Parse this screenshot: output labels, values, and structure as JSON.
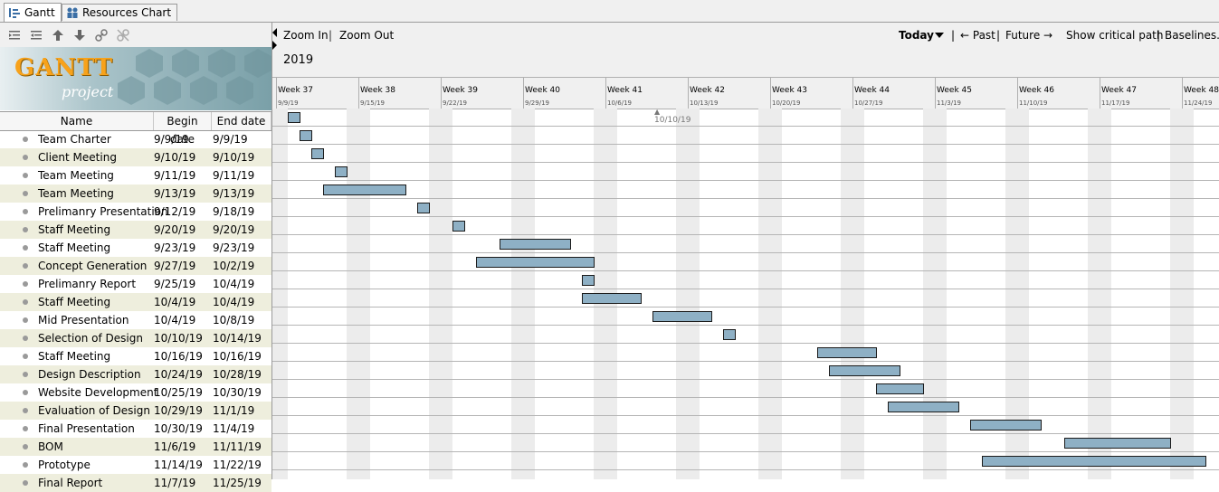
{
  "tabs": [
    {
      "label": "Gantt",
      "icon": "gantt-icon"
    },
    {
      "label": "Resources Chart",
      "icon": "resources-icon"
    }
  ],
  "toolbar_icons": [
    "indent-icon",
    "outdent-icon",
    "move-up-icon",
    "move-down-icon",
    "link-icon",
    "unlink-icon"
  ],
  "logo": {
    "word": "GANTT",
    "sub": "project"
  },
  "columns": {
    "name": "Name",
    "begin": "Begin date",
    "end": "End date"
  },
  "nav": {
    "zoom_in": "Zoom In",
    "zoom_out": "Zoom Out",
    "today": "Today",
    "past": "← Past",
    "future": "Future →",
    "critical": "Show critical path",
    "baselines": "Baselines...",
    "sep": "|"
  },
  "year": "2019",
  "today_marker": "10/10/19",
  "weeks": [
    {
      "label": "Week 37",
      "date": "9/9/19"
    },
    {
      "label": "Week 38",
      "date": "9/15/19"
    },
    {
      "label": "Week 39",
      "date": "9/22/19"
    },
    {
      "label": "Week 40",
      "date": "9/29/19"
    },
    {
      "label": "Week 41",
      "date": "10/6/19"
    },
    {
      "label": "Week 42",
      "date": "10/13/19"
    },
    {
      "label": "Week 43",
      "date": "10/20/19"
    },
    {
      "label": "Week 44",
      "date": "10/27/19"
    },
    {
      "label": "Week 45",
      "date": "11/3/19"
    },
    {
      "label": "Week 46",
      "date": "11/10/19"
    },
    {
      "label": "Week 47",
      "date": "11/17/19"
    },
    {
      "label": "Week 48",
      "date": "11/24/19"
    }
  ],
  "tasks": [
    {
      "name": "Team Charter",
      "begin": "9/9/19",
      "end": "9/9/19"
    },
    {
      "name": "Client Meeting",
      "begin": "9/10/19",
      "end": "9/10/19"
    },
    {
      "name": "Team Meeting",
      "begin": "9/11/19",
      "end": "9/11/19"
    },
    {
      "name": "Team Meeting",
      "begin": "9/13/19",
      "end": "9/13/19"
    },
    {
      "name": "Prelimanry Presentation",
      "begin": "9/12/19",
      "end": "9/18/19"
    },
    {
      "name": "Staff Meeting",
      "begin": "9/20/19",
      "end": "9/20/19"
    },
    {
      "name": "Staff Meeting",
      "begin": "9/23/19",
      "end": "9/23/19"
    },
    {
      "name": "Concept Generation",
      "begin": "9/27/19",
      "end": "10/2/19"
    },
    {
      "name": "Prelimanry Report",
      "begin": "9/25/19",
      "end": "10/4/19"
    },
    {
      "name": "Staff Meeting",
      "begin": "10/4/19",
      "end": "10/4/19"
    },
    {
      "name": "Mid Presentation",
      "begin": "10/4/19",
      "end": "10/8/19"
    },
    {
      "name": "Selection of Design",
      "begin": "10/10/19",
      "end": "10/14/19"
    },
    {
      "name": "Staff Meeting",
      "begin": "10/16/19",
      "end": "10/16/19"
    },
    {
      "name": "Design Description",
      "begin": "10/24/19",
      "end": "10/28/19"
    },
    {
      "name": "Website Development",
      "begin": "10/25/19",
      "end": "10/30/19"
    },
    {
      "name": "Evaluation of Design",
      "begin": "10/29/19",
      "end": "11/1/19"
    },
    {
      "name": "Final Presentation",
      "begin": "10/30/19",
      "end": "11/4/19"
    },
    {
      "name": "BOM",
      "begin": "11/6/19",
      "end": "11/11/19"
    },
    {
      "name": "Prototype",
      "begin": "11/14/19",
      "end": "11/22/19"
    },
    {
      "name": "Final Report",
      "begin": "11/7/19",
      "end": "11/25/19"
    }
  ],
  "colors": {
    "bar": "#8eb0c5",
    "row_alt": "#eeeedd",
    "weekend": "#ececec",
    "logo_orange": "#f7a21b"
  }
}
